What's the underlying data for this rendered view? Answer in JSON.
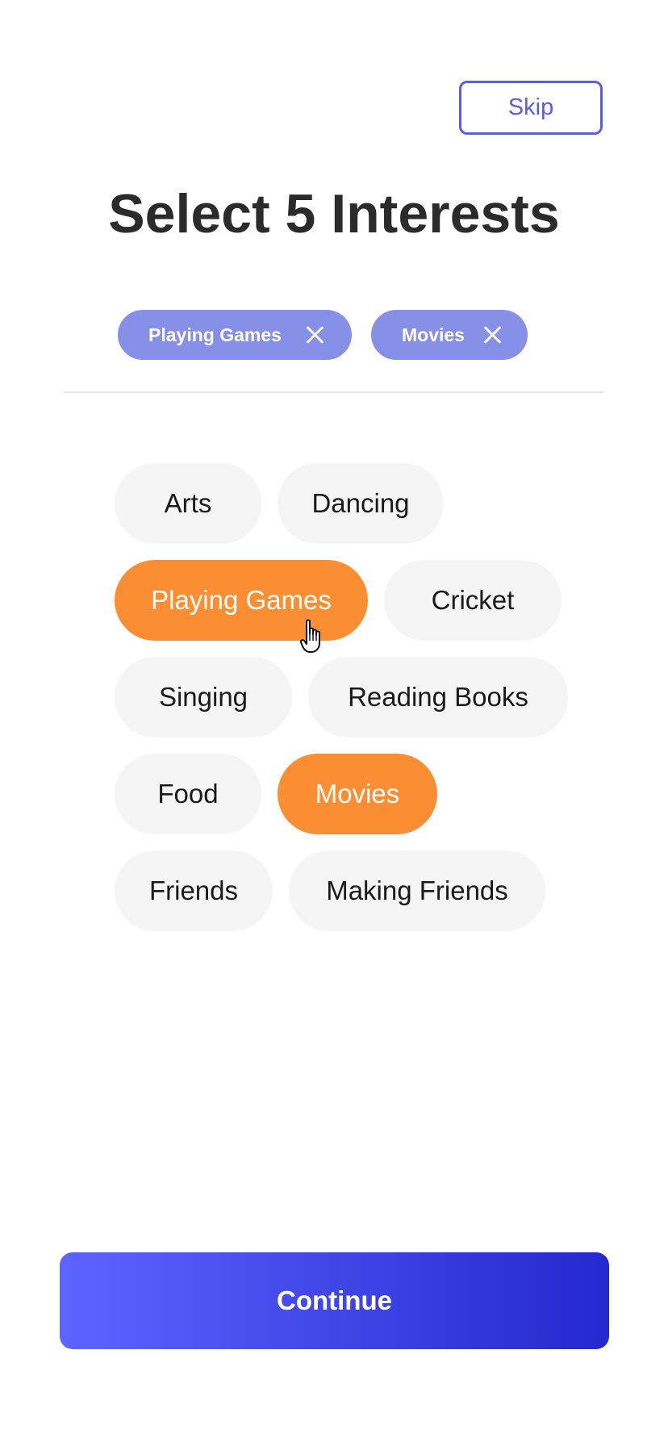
{
  "header": {
    "skip_label": "Skip"
  },
  "title": "Select 5 Interests",
  "selected_chips": [
    {
      "label": "Playing Games"
    },
    {
      "label": "Movies"
    }
  ],
  "interests": [
    {
      "label": "Arts",
      "selected": false
    },
    {
      "label": "Dancing",
      "selected": false
    },
    {
      "label": "Playing Games",
      "selected": true
    },
    {
      "label": "Cricket",
      "selected": false
    },
    {
      "label": "Singing",
      "selected": false
    },
    {
      "label": "Reading Books",
      "selected": false
    },
    {
      "label": "Food",
      "selected": false
    },
    {
      "label": "Movies",
      "selected": true
    },
    {
      "label": "Friends",
      "selected": false
    },
    {
      "label": "Making Friends",
      "selected": false
    }
  ],
  "footer": {
    "continue_label": "Continue"
  },
  "colors": {
    "accent": "#5a5fe0",
    "chip": "#8590e6",
    "selected": "#fb8e33",
    "unselected": "#f5f5f5",
    "gradient_start": "#5d64fe",
    "gradient_end": "#2428cf"
  },
  "icons": {
    "chip_remove": "close-icon",
    "cursor": "hand-pointer-icon"
  }
}
